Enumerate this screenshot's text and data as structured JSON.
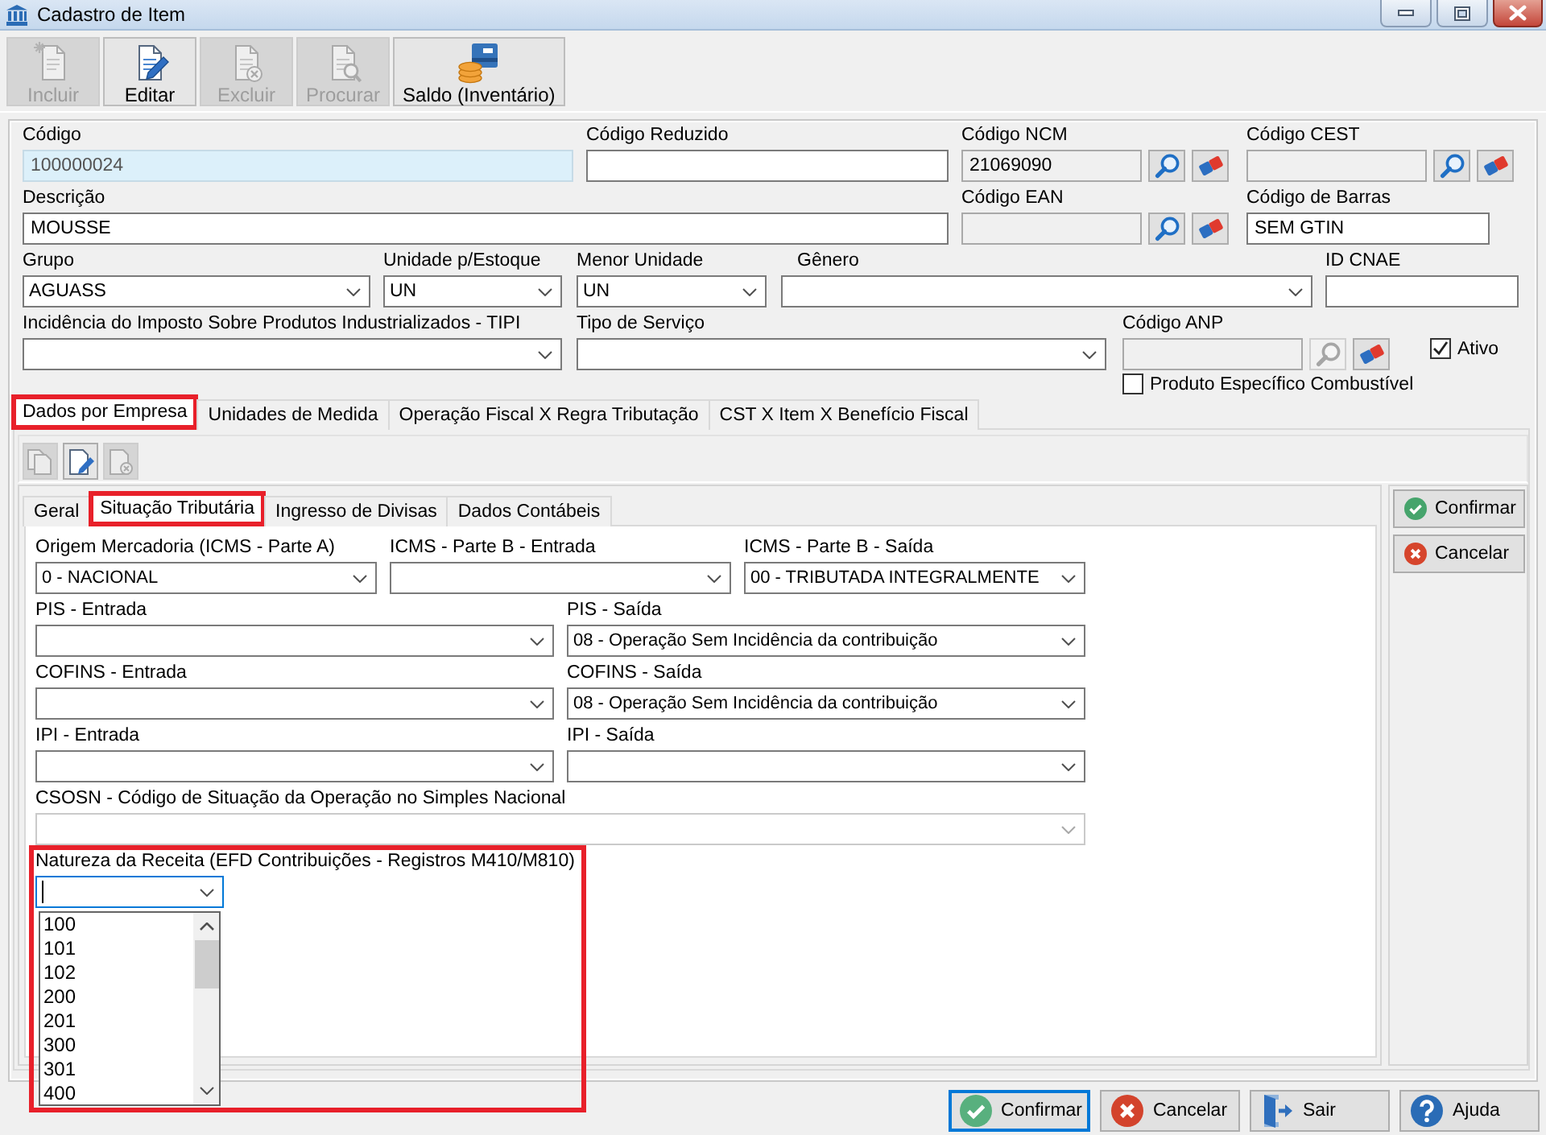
{
  "window": {
    "title": "Cadastro de Item"
  },
  "toolbar": [
    {
      "label": "Incluir",
      "disabled": true
    },
    {
      "label": "Editar",
      "disabled": false
    },
    {
      "label": "Excluir",
      "disabled": true
    },
    {
      "label": "Procurar",
      "disabled": true
    },
    {
      "label": "Saldo (Inventário)",
      "disabled": false
    }
  ],
  "form_rows": [
    [
      {
        "kind": "key",
        "label": "Código",
        "value": "100000024"
      },
      {
        "kind": "text",
        "label": "Código Reduzido"
      },
      {
        "kind": "lookup",
        "label": "Código NCM",
        "value": "21069090",
        "disabled": false
      },
      {
        "kind": "lookup",
        "label": "Código CEST",
        "disabled": false
      }
    ],
    [
      {
        "kind": "text",
        "label": "Descrição",
        "value": "MOUSSE"
      },
      {
        "kind": "lookup",
        "label": "Código EAN",
        "disabled": false
      },
      {
        "kind": "text",
        "label": "Código de Barras",
        "value": "SEM GTIN"
      }
    ],
    [
      {
        "kind": "combo",
        "label": "Grupo",
        "value": "AGUASS"
      },
      {
        "kind": "combo",
        "label": "Unidade p/Estoque",
        "value": "UN"
      },
      {
        "kind": "combo",
        "label": "Menor Unidade",
        "value": "UN"
      },
      {
        "kind": "combo",
        "label": "Gênero"
      },
      {
        "kind": "text",
        "label": "ID CNAE"
      }
    ],
    [
      {
        "kind": "combo",
        "label": "Incidência do Imposto Sobre Produtos Industrializados - TIPI"
      },
      {
        "kind": "combo",
        "label": "Tipo de Serviço"
      },
      {
        "kind": "lookup",
        "label": "Código ANP",
        "disabled": true
      },
      {
        "kind": "checkbox",
        "label": "Ativo",
        "checked": true
      }
    ],
    [
      {
        "kind": "checkbox",
        "label": "Produto Específico Combustível",
        "checked": false
      }
    ]
  ],
  "tabs": [
    {
      "label": "Dados por Empresa",
      "selected": true,
      "highlighted": true
    },
    {
      "label": "Unidades de Medida",
      "selected": false,
      "highlighted": false
    },
    {
      "label": "Operação Fiscal X Regra Tributação",
      "selected": false,
      "highlighted": false
    },
    {
      "label": "CST X Item X Benefício Fiscal",
      "selected": false,
      "highlighted": false
    }
  ],
  "company_toolbar": [
    {
      "disabled": true
    },
    {
      "disabled": false
    },
    {
      "disabled": true
    }
  ],
  "subtabs": [
    {
      "label": "Geral",
      "selected": false,
      "highlighted": false
    },
    {
      "label": "Situação Tributária",
      "selected": true,
      "highlighted": true
    },
    {
      "label": "Ingresso de Divisas",
      "selected": false,
      "highlighted": false
    },
    {
      "label": "Dados Contábeis",
      "selected": false,
      "highlighted": false
    }
  ],
  "tax_rows": [
    [
      {
        "label": "Origem Mercadoria (ICMS - Parte A)",
        "value": "0 - NACIONAL",
        "disabled": false
      },
      {
        "label": "ICMS - Parte B - Entrada",
        "disabled": false
      },
      {
        "label": "ICMS - Parte B - Saída",
        "value": "00 - TRIBUTADA INTEGRALMENTE",
        "disabled": false
      }
    ],
    [
      {
        "label": "PIS - Entrada",
        "disabled": false
      },
      {
        "label": "PIS - Saída",
        "value": "08 - Operação Sem Incidência da contribuição",
        "disabled": false
      }
    ],
    [
      {
        "label": "COFINS - Entrada",
        "disabled": false
      },
      {
        "label": "COFINS - Saída",
        "value": "08 - Operação Sem Incidência da contribuição",
        "disabled": false
      }
    ],
    [
      {
        "label": "IPI - Entrada",
        "disabled": false
      },
      {
        "label": "IPI - Saída",
        "disabled": false
      }
    ],
    [
      {
        "label": "CSOSN - Código de Situação da Operação no Simples Nacional",
        "disabled": true
      }
    ]
  ],
  "revenue_nature": {
    "label": "Natureza da Receita (EFD Contribuições - Registros M410/M810)",
    "focused": true,
    "expanded": true,
    "highlighted": true,
    "options": [
      "100",
      "101",
      "102",
      "200",
      "201",
      "300",
      "301",
      "400"
    ]
  },
  "side_buttons": [
    {
      "label": "Confirmar"
    },
    {
      "label": "Cancelar"
    }
  ],
  "footer_buttons": [
    {
      "label": "Confirmar",
      "focused": true
    },
    {
      "label": "Cancelar",
      "focused": false
    },
    {
      "label": "Sair",
      "focused": false
    },
    {
      "label": "Ajuda",
      "focused": false
    }
  ]
}
